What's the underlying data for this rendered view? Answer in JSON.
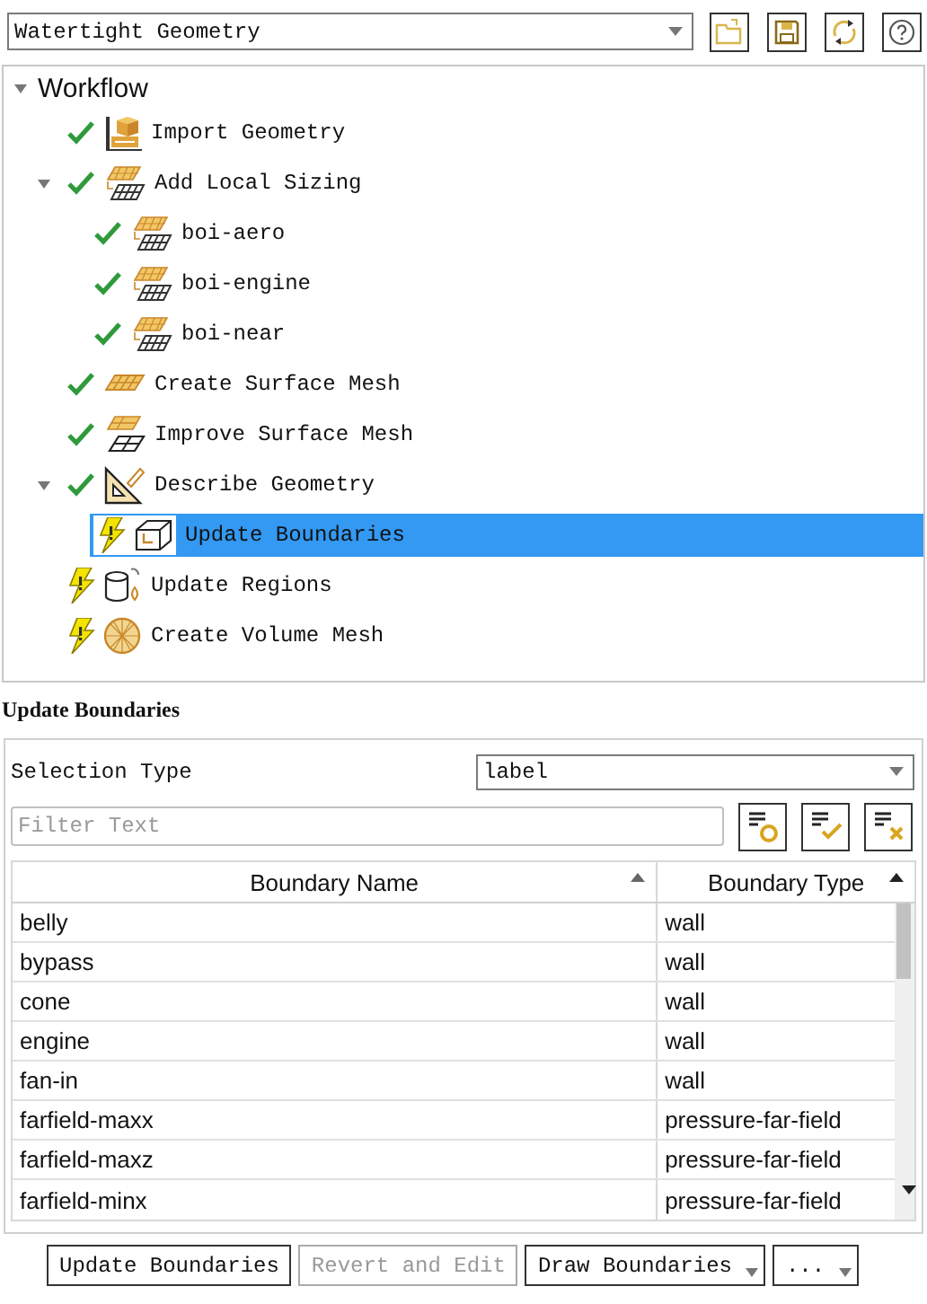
{
  "workflow_selector": {
    "value": "Watertight Geometry"
  },
  "tree": {
    "label": "Workflow",
    "expanded": true,
    "children": [
      {
        "label": "Import Geometry",
        "kind": "import",
        "done": true,
        "selected": false
      },
      {
        "label": "Add Local Sizing",
        "kind": "sizing",
        "done": true,
        "selected": false,
        "expanded": true,
        "children": [
          {
            "label": "boi-aero",
            "kind": "sizing",
            "done": true,
            "selected": false
          },
          {
            "label": "boi-engine",
            "kind": "sizing",
            "done": true,
            "selected": false
          },
          {
            "label": "boi-near",
            "kind": "sizing",
            "done": true,
            "selected": false
          }
        ]
      },
      {
        "label": "Create Surface Mesh",
        "kind": "surface-mesh",
        "done": true,
        "selected": false
      },
      {
        "label": "Improve Surface Mesh",
        "kind": "improve-mesh",
        "done": true,
        "selected": false
      },
      {
        "label": "Describe Geometry",
        "kind": "describe",
        "done": true,
        "selected": false,
        "expanded": true,
        "children": [
          {
            "label": "Update Boundaries",
            "kind": "boundaries",
            "done": false,
            "selected": true
          }
        ]
      },
      {
        "label": "Update Regions",
        "kind": "regions",
        "done": false,
        "selected": false
      },
      {
        "label": "Create Volume Mesh",
        "kind": "volume-mesh",
        "done": false,
        "selected": false
      }
    ]
  },
  "panel": {
    "title": "Update Boundaries",
    "selection_type": {
      "label": "Selection Type",
      "value": "label"
    },
    "filter": {
      "placeholder": "Filter Text"
    },
    "table": {
      "columns": [
        "Boundary Name",
        "Boundary Type"
      ],
      "rows": [
        [
          "belly",
          "wall"
        ],
        [
          "bypass",
          "wall"
        ],
        [
          "cone",
          "wall"
        ],
        [
          "engine",
          "wall"
        ],
        [
          "fan-in",
          "wall"
        ],
        [
          "farfield-maxx",
          "pressure-far-field"
        ],
        [
          "farfield-maxz",
          "pressure-far-field"
        ],
        [
          "farfield-minx",
          "pressure-far-field"
        ]
      ]
    }
  },
  "buttons": [
    {
      "label": "Update Boundaries",
      "kind": "button",
      "disabled": false
    },
    {
      "label": "Revert and Edit",
      "kind": "button",
      "disabled": true
    },
    {
      "label": "Draw Boundaries",
      "kind": "dropdown",
      "disabled": false
    },
    {
      "label": "...",
      "kind": "dropdown",
      "disabled": false
    }
  ]
}
